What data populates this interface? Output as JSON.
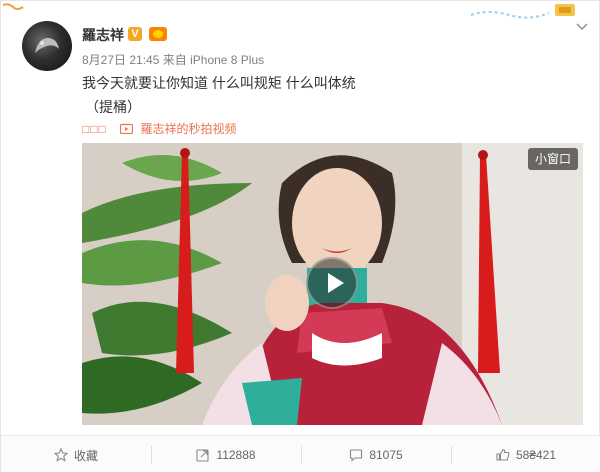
{
  "post": {
    "author": "羅志祥",
    "verified_badge": "V",
    "meta": {
      "date": "8月27日 21:45",
      "from": "来自",
      "device": "iPhone 8 Plus"
    },
    "text": "我今天就要让你知道 什么叫规矩 什么叫体统",
    "tag": "（提桶）",
    "source": {
      "boxes": "□□□",
      "link": "羅志祥的秒拍视频"
    },
    "video": {
      "mini_window_label": "小窗口"
    }
  },
  "actions": {
    "favorite": "收藏",
    "repost_count": "112888",
    "comment_count": "81075",
    "like_count": "58₴421"
  },
  "colors": {
    "accent": "#eb7350",
    "verified": "#f5a623"
  },
  "icons": [
    "collapse-chevron-icon",
    "video-source-icon",
    "play-icon",
    "star-icon",
    "repost-icon",
    "comment-icon",
    "like-icon"
  ]
}
